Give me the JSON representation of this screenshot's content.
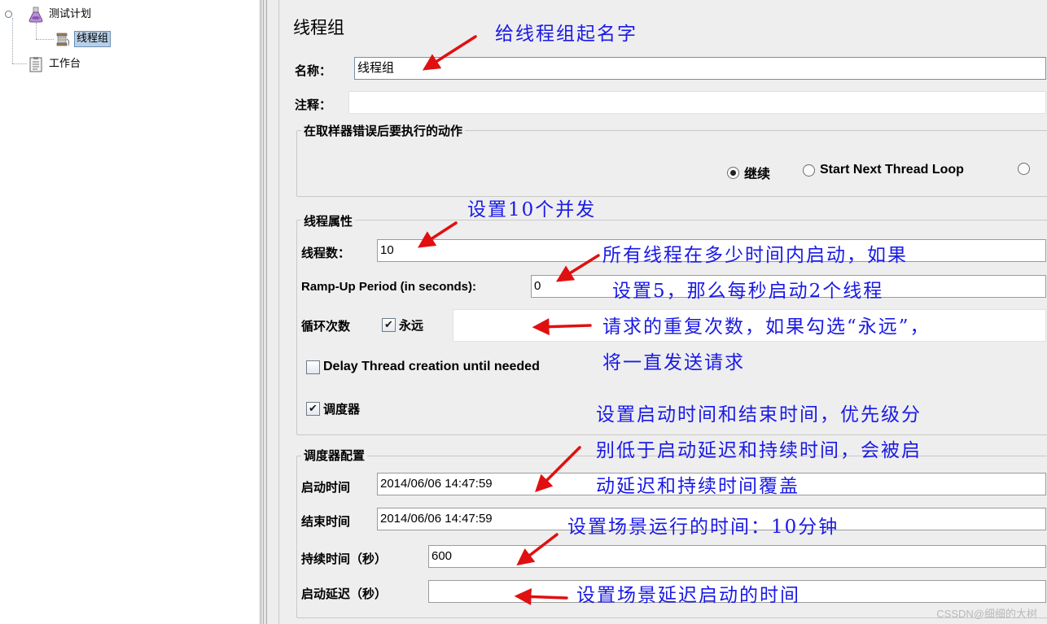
{
  "tree": {
    "test_plan": "测试计划",
    "thread_group": "线程组",
    "workbench": "工作台"
  },
  "panel": {
    "title": "线程组",
    "name_label": "名称：",
    "name_value": "线程组",
    "comment_label": "注释：",
    "comment_value": "",
    "error_group_title": "在取样器错误后要执行的动作",
    "radio_continue": "继续",
    "radio_next_loop": "Start Next Thread Loop",
    "thread_props_title": "线程属性",
    "threads_label": "线程数：",
    "threads_value": "10",
    "rampup_label": "Ramp-Up Period (in seconds):",
    "rampup_value": "0",
    "loop_label": "循环次数",
    "forever_label": "永远",
    "loop_value": "",
    "delay_label": "Delay Thread creation until needed",
    "scheduler_label": "调度器",
    "scheduler_group_title": "调度器配置",
    "start_label": "启动时间",
    "start_value": "2014/06/06 14:47:59",
    "end_label": "结束时间",
    "end_value": "2014/06/06 14:47:59",
    "duration_label": "持续时间（秒）",
    "duration_value": "600",
    "delay_label2": "启动延迟（秒）",
    "delay_value": ""
  },
  "annotations": {
    "name": "给线程组起名字",
    "threads": "设置10个并发",
    "rampup_1": "所有线程在多少时间内启动，如果",
    "rampup_2": "设置5，那么每秒启动2个线程",
    "loop_1": "请求的重复次数，如果勾选“永远”，",
    "loop_2": "将一直发送请求",
    "sched_1": "设置启动时间和结束时间，优先级分",
    "sched_2": "别低于启动延迟和持续时间，会被启",
    "sched_3": "动延迟和持续时间覆盖",
    "duration": "设置场景运行的时间：10分钟",
    "delay": "设置场景延迟启动的时间"
  },
  "watermark": "CSSDN@细细的大树",
  "colors": {
    "annotation": "#1a1ae6",
    "arrow": "#e01010",
    "panel_bg": "#eeeeee",
    "selection": "#b8cfe5"
  }
}
